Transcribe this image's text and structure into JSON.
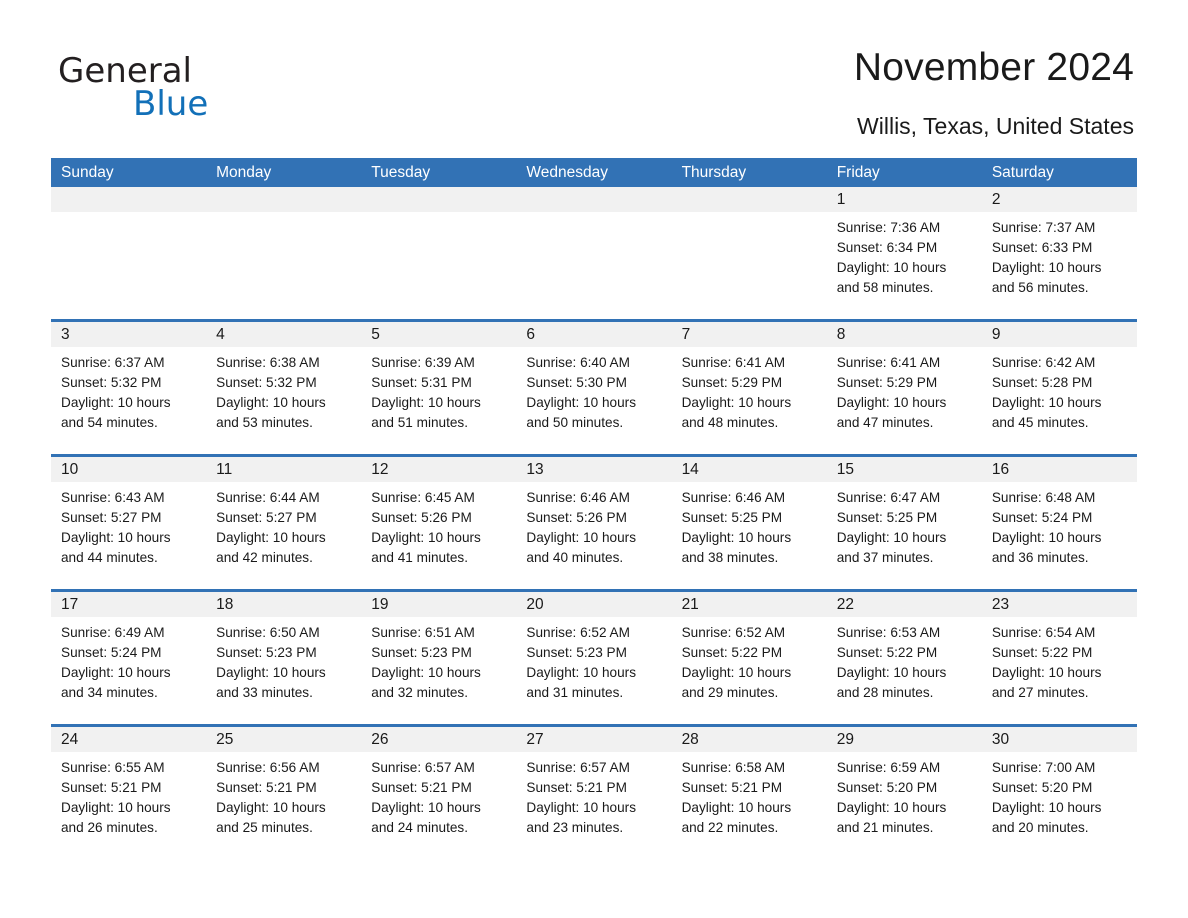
{
  "logo": {
    "word1": "General",
    "word2": "Blue",
    "triangle_icon": "blue-triangle-icon",
    "color_dark": "#231f20",
    "color_blue": "#1270b8"
  },
  "header": {
    "title": "November 2024",
    "location": "Willis, Texas, United States"
  },
  "theme": {
    "header_blue": "#3272b5",
    "day_band_gray": "#f1f1f1",
    "text": "#1a1a1a",
    "white": "#ffffff"
  },
  "calendar": {
    "day_headers": [
      "Sunday",
      "Monday",
      "Tuesday",
      "Wednesday",
      "Thursday",
      "Friday",
      "Saturday"
    ],
    "weeks": [
      [
        {
          "day": "",
          "empty": true
        },
        {
          "day": "",
          "empty": true
        },
        {
          "day": "",
          "empty": true
        },
        {
          "day": "",
          "empty": true
        },
        {
          "day": "",
          "empty": true
        },
        {
          "day": "1",
          "sunrise": "Sunrise: 7:36 AM",
          "sunset": "Sunset: 6:34 PM",
          "daylight1": "Daylight: 10 hours",
          "daylight2": "and 58 minutes."
        },
        {
          "day": "2",
          "sunrise": "Sunrise: 7:37 AM",
          "sunset": "Sunset: 6:33 PM",
          "daylight1": "Daylight: 10 hours",
          "daylight2": "and 56 minutes."
        }
      ],
      [
        {
          "day": "3",
          "sunrise": "Sunrise: 6:37 AM",
          "sunset": "Sunset: 5:32 PM",
          "daylight1": "Daylight: 10 hours",
          "daylight2": "and 54 minutes."
        },
        {
          "day": "4",
          "sunrise": "Sunrise: 6:38 AM",
          "sunset": "Sunset: 5:32 PM",
          "daylight1": "Daylight: 10 hours",
          "daylight2": "and 53 minutes."
        },
        {
          "day": "5",
          "sunrise": "Sunrise: 6:39 AM",
          "sunset": "Sunset: 5:31 PM",
          "daylight1": "Daylight: 10 hours",
          "daylight2": "and 51 minutes."
        },
        {
          "day": "6",
          "sunrise": "Sunrise: 6:40 AM",
          "sunset": "Sunset: 5:30 PM",
          "daylight1": "Daylight: 10 hours",
          "daylight2": "and 50 minutes."
        },
        {
          "day": "7",
          "sunrise": "Sunrise: 6:41 AM",
          "sunset": "Sunset: 5:29 PM",
          "daylight1": "Daylight: 10 hours",
          "daylight2": "and 48 minutes."
        },
        {
          "day": "8",
          "sunrise": "Sunrise: 6:41 AM",
          "sunset": "Sunset: 5:29 PM",
          "daylight1": "Daylight: 10 hours",
          "daylight2": "and 47 minutes."
        },
        {
          "day": "9",
          "sunrise": "Sunrise: 6:42 AM",
          "sunset": "Sunset: 5:28 PM",
          "daylight1": "Daylight: 10 hours",
          "daylight2": "and 45 minutes."
        }
      ],
      [
        {
          "day": "10",
          "sunrise": "Sunrise: 6:43 AM",
          "sunset": "Sunset: 5:27 PM",
          "daylight1": "Daylight: 10 hours",
          "daylight2": "and 44 minutes."
        },
        {
          "day": "11",
          "sunrise": "Sunrise: 6:44 AM",
          "sunset": "Sunset: 5:27 PM",
          "daylight1": "Daylight: 10 hours",
          "daylight2": "and 42 minutes."
        },
        {
          "day": "12",
          "sunrise": "Sunrise: 6:45 AM",
          "sunset": "Sunset: 5:26 PM",
          "daylight1": "Daylight: 10 hours",
          "daylight2": "and 41 minutes."
        },
        {
          "day": "13",
          "sunrise": "Sunrise: 6:46 AM",
          "sunset": "Sunset: 5:26 PM",
          "daylight1": "Daylight: 10 hours",
          "daylight2": "and 40 minutes."
        },
        {
          "day": "14",
          "sunrise": "Sunrise: 6:46 AM",
          "sunset": "Sunset: 5:25 PM",
          "daylight1": "Daylight: 10 hours",
          "daylight2": "and 38 minutes."
        },
        {
          "day": "15",
          "sunrise": "Sunrise: 6:47 AM",
          "sunset": "Sunset: 5:25 PM",
          "daylight1": "Daylight: 10 hours",
          "daylight2": "and 37 minutes."
        },
        {
          "day": "16",
          "sunrise": "Sunrise: 6:48 AM",
          "sunset": "Sunset: 5:24 PM",
          "daylight1": "Daylight: 10 hours",
          "daylight2": "and 36 minutes."
        }
      ],
      [
        {
          "day": "17",
          "sunrise": "Sunrise: 6:49 AM",
          "sunset": "Sunset: 5:24 PM",
          "daylight1": "Daylight: 10 hours",
          "daylight2": "and 34 minutes."
        },
        {
          "day": "18",
          "sunrise": "Sunrise: 6:50 AM",
          "sunset": "Sunset: 5:23 PM",
          "daylight1": "Daylight: 10 hours",
          "daylight2": "and 33 minutes."
        },
        {
          "day": "19",
          "sunrise": "Sunrise: 6:51 AM",
          "sunset": "Sunset: 5:23 PM",
          "daylight1": "Daylight: 10 hours",
          "daylight2": "and 32 minutes."
        },
        {
          "day": "20",
          "sunrise": "Sunrise: 6:52 AM",
          "sunset": "Sunset: 5:23 PM",
          "daylight1": "Daylight: 10 hours",
          "daylight2": "and 31 minutes."
        },
        {
          "day": "21",
          "sunrise": "Sunrise: 6:52 AM",
          "sunset": "Sunset: 5:22 PM",
          "daylight1": "Daylight: 10 hours",
          "daylight2": "and 29 minutes."
        },
        {
          "day": "22",
          "sunrise": "Sunrise: 6:53 AM",
          "sunset": "Sunset: 5:22 PM",
          "daylight1": "Daylight: 10 hours",
          "daylight2": "and 28 minutes."
        },
        {
          "day": "23",
          "sunrise": "Sunrise: 6:54 AM",
          "sunset": "Sunset: 5:22 PM",
          "daylight1": "Daylight: 10 hours",
          "daylight2": "and 27 minutes."
        }
      ],
      [
        {
          "day": "24",
          "sunrise": "Sunrise: 6:55 AM",
          "sunset": "Sunset: 5:21 PM",
          "daylight1": "Daylight: 10 hours",
          "daylight2": "and 26 minutes."
        },
        {
          "day": "25",
          "sunrise": "Sunrise: 6:56 AM",
          "sunset": "Sunset: 5:21 PM",
          "daylight1": "Daylight: 10 hours",
          "daylight2": "and 25 minutes."
        },
        {
          "day": "26",
          "sunrise": "Sunrise: 6:57 AM",
          "sunset": "Sunset: 5:21 PM",
          "daylight1": "Daylight: 10 hours",
          "daylight2": "and 24 minutes."
        },
        {
          "day": "27",
          "sunrise": "Sunrise: 6:57 AM",
          "sunset": "Sunset: 5:21 PM",
          "daylight1": "Daylight: 10 hours",
          "daylight2": "and 23 minutes."
        },
        {
          "day": "28",
          "sunrise": "Sunrise: 6:58 AM",
          "sunset": "Sunset: 5:21 PM",
          "daylight1": "Daylight: 10 hours",
          "daylight2": "and 22 minutes."
        },
        {
          "day": "29",
          "sunrise": "Sunrise: 6:59 AM",
          "sunset": "Sunset: 5:20 PM",
          "daylight1": "Daylight: 10 hours",
          "daylight2": "and 21 minutes."
        },
        {
          "day": "30",
          "sunrise": "Sunrise: 7:00 AM",
          "sunset": "Sunset: 5:20 PM",
          "daylight1": "Daylight: 10 hours",
          "daylight2": "and 20 minutes."
        }
      ]
    ]
  }
}
